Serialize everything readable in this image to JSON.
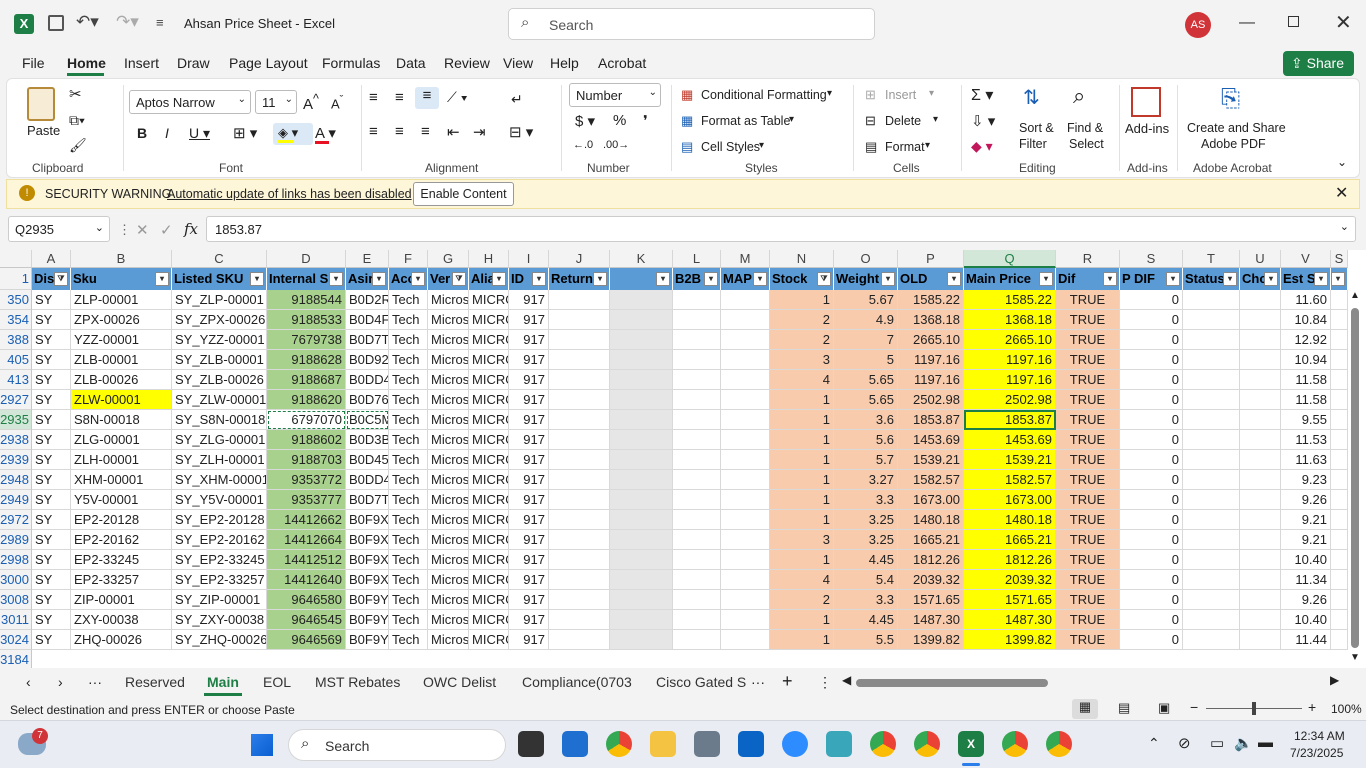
{
  "window": {
    "title": "Ahsan Price Sheet  -  Excel",
    "search_placeholder": "Search",
    "user_initials": "AS"
  },
  "menu": [
    "File",
    "Home",
    "Insert",
    "Draw",
    "Page Layout",
    "Formulas",
    "Data",
    "Review",
    "View",
    "Help",
    "Acrobat"
  ],
  "share_label": "Share",
  "ribbon": {
    "paste": "Paste",
    "clipboard": "Clipboard",
    "font_name": "Aptos Narrow",
    "font_size": "11",
    "font_group": "Font",
    "alignment": "Alignment",
    "number_format": "Number",
    "number_group": "Number",
    "cond_format": "Conditional Formatting",
    "format_table": "Format as Table",
    "cell_styles": "Cell Styles",
    "styles_group": "Styles",
    "insert": "Insert",
    "delete": "Delete",
    "format": "Format",
    "cells_group": "Cells",
    "sort_filter_1": "Sort &",
    "sort_filter_2": "Filter",
    "find_select_1": "Find &",
    "find_select_2": "Select",
    "editing_group": "Editing",
    "addins": "Add-ins",
    "addins_group": "Add-ins",
    "create_share_1": "Create and Share",
    "create_share_2": "Adobe PDF",
    "acrobat_group": "Adobe Acrobat"
  },
  "warning": {
    "title": "SECURITY WARNING",
    "message": "Automatic update of links has been disabled",
    "button": "Enable Content"
  },
  "formula": {
    "name_box": "Q2935",
    "value": "1853.87"
  },
  "columns": [
    "A",
    "B",
    "C",
    "D",
    "E",
    "F",
    "G",
    "H",
    "I",
    "J",
    "K",
    "L",
    "M",
    "N",
    "O",
    "P",
    "Q",
    "R",
    "S",
    "T",
    "U",
    "V",
    "S"
  ],
  "headers": [
    "Dis",
    "Sku",
    "Listed SKU",
    "Internal S",
    "Asir",
    "Acc",
    "Ver",
    "Alia",
    "ID",
    "Return",
    "",
    "B2B",
    "MAP",
    "Stock",
    "Weight",
    "OLD",
    "Main Price",
    "Dif",
    "P DIF",
    "Status",
    "Cho",
    "Est S",
    "S"
  ],
  "header_row_num": "1",
  "rows": [
    {
      "n": "350",
      "a": "SY",
      "b": "ZLP-00001",
      "c": "SY_ZLP-00001",
      "d": "9188544",
      "e": "B0D2RI",
      "f": "Tech",
      "g": "Micros",
      "h": "MICRO",
      "i": "917",
      "n2": "1",
      "o": "5.67",
      "p": "1585.22",
      "q": "1585.22",
      "r": "TRUE",
      "s": "0",
      "v": "11.60"
    },
    {
      "n": "354",
      "a": "SY",
      "b": "ZPX-00026",
      "c": "SY_ZPX-00026",
      "d": "9188533",
      "e": "B0D4F1",
      "f": "Tech",
      "g": "Micros",
      "h": "MICRO",
      "i": "917",
      "n2": "2",
      "o": "4.9",
      "p": "1368.18",
      "q": "1368.18",
      "r": "TRUE",
      "s": "0",
      "v": "10.84"
    },
    {
      "n": "388",
      "a": "SY",
      "b": "YZZ-00001",
      "c": "SY_YZZ-00001",
      "d": "7679738",
      "e": "B0D7TI",
      "f": "Tech",
      "g": "Micros",
      "h": "MICRO",
      "i": "917",
      "n2": "2",
      "o": "7",
      "p": "2665.10",
      "q": "2665.10",
      "r": "TRUE",
      "s": "0",
      "v": "12.92"
    },
    {
      "n": "405",
      "a": "SY",
      "b": "ZLB-00001",
      "c": "SY_ZLB-00001",
      "d": "9188628",
      "e": "B0D92I",
      "f": "Tech",
      "g": "Micros",
      "h": "MICRO",
      "i": "917",
      "n2": "3",
      "o": "5",
      "p": "1197.16",
      "q": "1197.16",
      "r": "TRUE",
      "s": "0",
      "v": "10.94"
    },
    {
      "n": "413",
      "a": "SY",
      "b": "ZLB-00026",
      "c": "SY_ZLB-00026",
      "d": "9188687",
      "e": "B0DD4",
      "f": "Tech",
      "g": "Micros",
      "h": "MICRO",
      "i": "917",
      "n2": "4",
      "o": "5.65",
      "p": "1197.16",
      "q": "1197.16",
      "r": "TRUE",
      "s": "0",
      "v": "11.58"
    },
    {
      "n": "2927",
      "a": "SY",
      "b": "ZLW-00001",
      "c": "SY_ZLW-00001",
      "d": "9188620",
      "e": "B0D76V",
      "f": "Tech",
      "g": "Micros",
      "h": "MICRO",
      "i": "917",
      "n2": "1",
      "o": "5.65",
      "p": "2502.98",
      "q": "2502.98",
      "r": "TRUE",
      "s": "0",
      "v": "11.58"
    },
    {
      "n": "2935",
      "a": "SY",
      "b": "S8N-00018",
      "c": "SY_S8N-00018",
      "d": "6797070",
      "e": "B0C5M",
      "f": "Tech",
      "g": "Micros",
      "h": "MICRO",
      "i": "917",
      "n2": "1",
      "o": "3.6",
      "p": "1853.87",
      "q": "1853.87",
      "r": "TRUE",
      "s": "0",
      "v": "9.55"
    },
    {
      "n": "2938",
      "a": "SY",
      "b": "ZLG-00001",
      "c": "SY_ZLG-00001",
      "d": "9188602",
      "e": "B0D3B7",
      "f": "Tech",
      "g": "Micros",
      "h": "MICRO",
      "i": "917",
      "n2": "1",
      "o": "5.6",
      "p": "1453.69",
      "q": "1453.69",
      "r": "TRUE",
      "s": "0",
      "v": "11.53"
    },
    {
      "n": "2939",
      "a": "SY",
      "b": "ZLH-00001",
      "c": "SY_ZLH-00001",
      "d": "9188703",
      "e": "B0D45T",
      "f": "Tech",
      "g": "Micros",
      "h": "MICRO",
      "i": "917",
      "n2": "1",
      "o": "5.7",
      "p": "1539.21",
      "q": "1539.21",
      "r": "TRUE",
      "s": "0",
      "v": "11.63"
    },
    {
      "n": "2948",
      "a": "SY",
      "b": "XHM-00001",
      "c": "SY_XHM-00001",
      "d": "9353772",
      "e": "B0DD4",
      "f": "Tech",
      "g": "Micros",
      "h": "MICRO",
      "i": "917",
      "n2": "1",
      "o": "3.27",
      "p": "1582.57",
      "q": "1582.57",
      "r": "TRUE",
      "s": "0",
      "v": "9.23"
    },
    {
      "n": "2949",
      "a": "SY",
      "b": "Y5V-00001",
      "c": "SY_Y5V-00001",
      "d": "9353777",
      "e": "B0D7TI",
      "f": "Tech",
      "g": "Micros",
      "h": "MICRO",
      "i": "917",
      "n2": "1",
      "o": "3.3",
      "p": "1673.00",
      "q": "1673.00",
      "r": "TRUE",
      "s": "0",
      "v": "9.26"
    },
    {
      "n": "2972",
      "a": "SY",
      "b": "EP2-20128",
      "c": "SY_EP2-20128",
      "d": "14412662",
      "e": "B0F9XS",
      "f": "Tech",
      "g": "Micros",
      "h": "MICRO",
      "i": "917",
      "n2": "1",
      "o": "3.25",
      "p": "1480.18",
      "q": "1480.18",
      "r": "TRUE",
      "s": "0",
      "v": "9.21"
    },
    {
      "n": "2989",
      "a": "SY",
      "b": "EP2-20162",
      "c": "SY_EP2-20162",
      "d": "14412664",
      "e": "B0F9X6",
      "f": "Tech",
      "g": "Micros",
      "h": "MICRO",
      "i": "917",
      "n2": "3",
      "o": "3.25",
      "p": "1665.21",
      "q": "1665.21",
      "r": "TRUE",
      "s": "0",
      "v": "9.21"
    },
    {
      "n": "2998",
      "a": "SY",
      "b": "EP2-33245",
      "c": "SY_EP2-33245",
      "d": "14412512",
      "e": "B0F9X8",
      "f": "Tech",
      "g": "Micros",
      "h": "MICRO",
      "i": "917",
      "n2": "1",
      "o": "4.45",
      "p": "1812.26",
      "q": "1812.26",
      "r": "TRUE",
      "s": "0",
      "v": "10.40"
    },
    {
      "n": "3000",
      "a": "SY",
      "b": "EP2-33257",
      "c": "SY_EP2-33257",
      "d": "14412640",
      "e": "B0F9XC",
      "f": "Tech",
      "g": "Micros",
      "h": "MICRO",
      "i": "917",
      "n2": "4",
      "o": "5.4",
      "p": "2039.32",
      "q": "2039.32",
      "r": "TRUE",
      "s": "0",
      "v": "11.34"
    },
    {
      "n": "3008",
      "a": "SY",
      "b": "ZIP-00001",
      "c": "SY_ZIP-00001",
      "d": "9646580",
      "e": "B0F9YK",
      "f": "Tech",
      "g": "Micros",
      "h": "MICRO",
      "i": "917",
      "n2": "2",
      "o": "3.3",
      "p": "1571.65",
      "q": "1571.65",
      "r": "TRUE",
      "s": "0",
      "v": "9.26"
    },
    {
      "n": "3011",
      "a": "SY",
      "b": "ZXY-00038",
      "c": "SY_ZXY-00038",
      "d": "9646545",
      "e": "B0F9YV",
      "f": "Tech",
      "g": "Micros",
      "h": "MICRO",
      "i": "917",
      "n2": "1",
      "o": "4.45",
      "p": "1487.30",
      "q": "1487.30",
      "r": "TRUE",
      "s": "0",
      "v": "10.40"
    },
    {
      "n": "3024",
      "a": "SY",
      "b": "ZHQ-00026",
      "c": "SY_ZHQ-00026",
      "d": "9646569",
      "e": "B0F9YX",
      "f": "Tech",
      "g": "Micros",
      "h": "MICRO",
      "i": "917",
      "n2": "1",
      "o": "5.5",
      "p": "1399.82",
      "q": "1399.82",
      "r": "TRUE",
      "s": "0",
      "v": "11.44"
    }
  ],
  "last_row_num": "3184",
  "sheets": [
    "Reserved",
    "Main",
    "EOL",
    "MST Rebates",
    "OWC Delist",
    "Compliance(0703",
    "Cisco Gated S"
  ],
  "active_sheet": "Main",
  "status_text": "Select destination and press ENTER or choose Paste",
  "zoom": "100%",
  "taskbar": {
    "search_placeholder": "Search",
    "weather_badge": "7",
    "time": "12:34 AM",
    "date": "7/23/2025"
  },
  "colors": {
    "header_blue": "#5b9bd5",
    "green": "#a9d18e",
    "salmon": "#f8cbad",
    "yellow": "#ffff00",
    "grey": "#e7e6e6",
    "excel_green": "#1d7f45"
  }
}
